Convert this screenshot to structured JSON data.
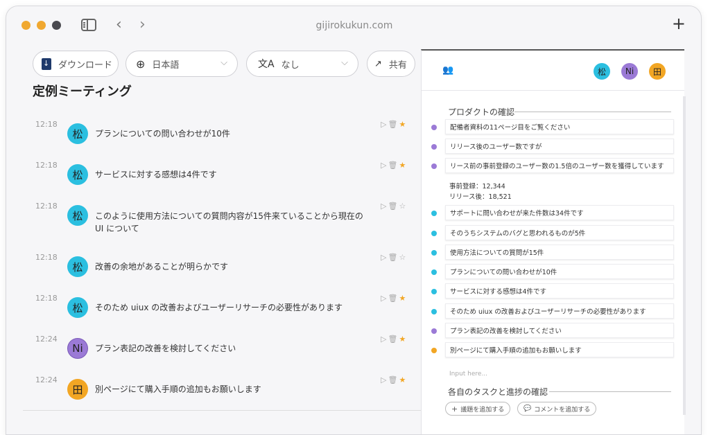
{
  "window": {
    "url": "gijirokukun.com"
  },
  "toolbar": {
    "download_label": "ダウンロード",
    "language_label": "日本語",
    "translate_label": "なし",
    "share_label": "共有"
  },
  "meeting": {
    "title": "定例ミーティング"
  },
  "transcript": [
    {
      "time": "12:18",
      "speaker": "松",
      "text": "プランについての問い合わせが10件",
      "starred": true
    },
    {
      "time": "12:18",
      "speaker": "松",
      "text": "サービスに対する感想は4件です",
      "starred": true
    },
    {
      "time": "12:18",
      "speaker": "松",
      "text": "このように使用方法についての質問内容が15件来ていることから現在の UI について",
      "starred": false
    },
    {
      "time": "12:18",
      "speaker": "松",
      "text": "改善の余地があることが明らかです",
      "starred": false
    },
    {
      "time": "12:18",
      "speaker": "松",
      "text": "そのため uiux の改善およびユーザーリサーチの必要性があります",
      "starred": true
    },
    {
      "time": "12:24",
      "speaker": "Ni",
      "text": "プラン表記の改善を検討してください",
      "starred": true
    },
    {
      "time": "12:24",
      "speaker": "田",
      "text": "別ページにて購入手順の追加もお願いします",
      "starred": true
    }
  ],
  "panel": {
    "participants": [
      "松",
      "Ni",
      "田"
    ],
    "section1_title": "プロダクトの確認",
    "items": [
      {
        "text": "配備者資料の11ページ目をご覧ください",
        "color": "#9b7ad6"
      },
      {
        "text": "リリース後のユーザー数ですが",
        "color": "#9b7ad6"
      },
      {
        "text": "リース前の事前登録のユーザー数の1.5倍のユーザー数を獲得しています",
        "color": "#9b7ad6"
      },
      {
        "text": "サポートに問い合わせが来た件数は34件です",
        "color": "#2bbfe0"
      },
      {
        "text": "そのうちシステムのバグと思われるものが5件",
        "color": "#2bbfe0"
      },
      {
        "text": "使用方法についての質問が15件",
        "color": "#2bbfe0"
      },
      {
        "text": "プランについての問い合わせが10件",
        "color": "#2bbfe0"
      },
      {
        "text": "サービスに対する感想は4件です",
        "color": "#2bbfe0"
      },
      {
        "text": "そのため uiux の改善およびユーザーリサーチの必要性があります",
        "color": "#2bbfe0"
      },
      {
        "text": "プラン表記の改善を検討してください",
        "color": "#9b7ad6"
      },
      {
        "text": "別ページにて購入手順の追加もお願いします",
        "color": "#f2a624"
      }
    ],
    "stats_line1": "事前登録：12,344",
    "stats_line2": "リリース後：18,521",
    "input_placeholder": "Input here...",
    "section2_title": "各自のタスクと進捗の確認",
    "add_topic_label": "議題を追加する",
    "add_comment_label": "コメントを追加する"
  }
}
